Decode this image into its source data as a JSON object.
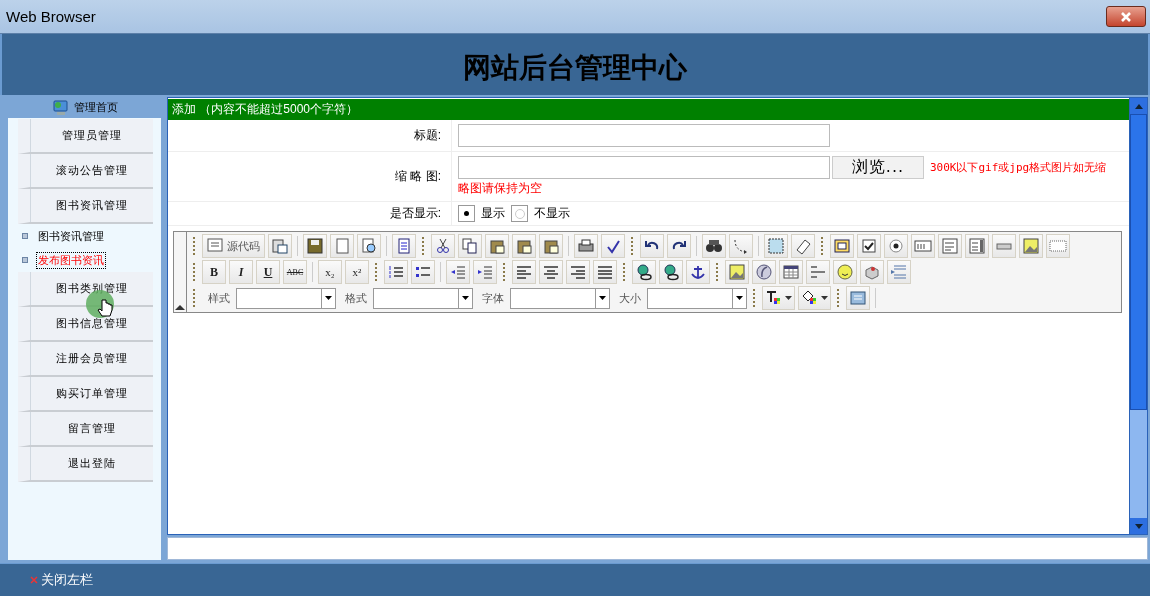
{
  "window": {
    "title": "Web Browser"
  },
  "header": {
    "title": "网站后台管理中心"
  },
  "sidebar": {
    "home": "管理首页",
    "items": [
      {
        "label": "管理员管理",
        "kind": "button",
        "selected": false
      },
      {
        "label": "滚动公告管理",
        "kind": "button",
        "selected": false
      },
      {
        "label": "图书资讯管理",
        "kind": "button",
        "selected": false
      },
      {
        "label": "图书资讯管理",
        "kind": "link",
        "selected": false
      },
      {
        "label": "发布图书资讯",
        "kind": "link",
        "selected": true
      },
      {
        "label": "图书类别管理",
        "kind": "button",
        "selected": false
      },
      {
        "label": "图书信息管理",
        "kind": "button",
        "selected": false
      },
      {
        "label": "注册会员管理",
        "kind": "button",
        "selected": false
      },
      {
        "label": "购买订单管理",
        "kind": "button",
        "selected": false
      },
      {
        "label": "留言管理",
        "kind": "button",
        "selected": false
      },
      {
        "label": "退出登陆",
        "kind": "button",
        "selected": false
      }
    ]
  },
  "form": {
    "heading": "添加 （内容不能超过5000个字符）",
    "title_label": "标题:",
    "thumb_label": "缩 略 图:",
    "browse_button": "浏览...",
    "thumb_hint": "300K以下gif或jpg格式图片如无缩",
    "thumb_note": "略图请保持为空",
    "show_label": "是否显示:",
    "options": [
      {
        "label": "显示",
        "selected": true
      },
      {
        "label": "不显示",
        "selected": false
      }
    ]
  },
  "editor": {
    "source": "源代码",
    "bold": "B",
    "italic": "I",
    "underline": "U",
    "strike": "ABC",
    "subscript": "x₂",
    "superscript": "x²",
    "style": "样式",
    "format": "格式",
    "font": "字体",
    "size": "大小"
  },
  "footer": {
    "close_left": "关闭左栏"
  }
}
